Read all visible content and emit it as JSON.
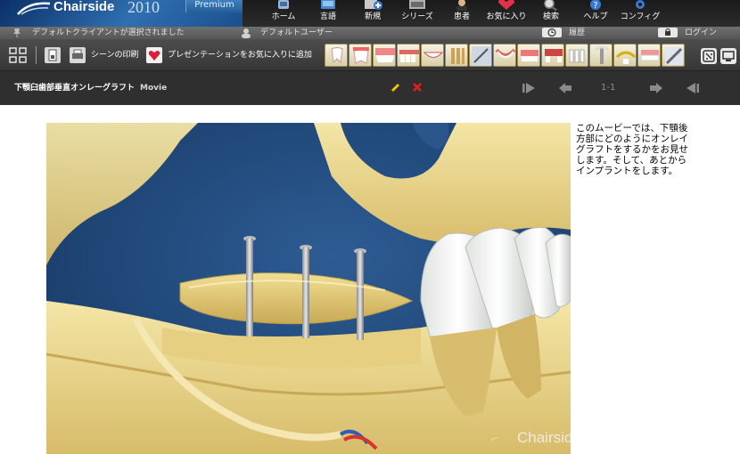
{
  "header": {
    "brand_name": "Chairside",
    "brand_year": "2010",
    "brand_edition": "Premium",
    "nav": [
      {
        "label": "ホーム",
        "icon": "home-icon"
      },
      {
        "label": "言語",
        "icon": "language-icon"
      },
      {
        "label": "新規",
        "icon": "new-icon"
      },
      {
        "label": "シリーズ",
        "icon": "series-icon"
      },
      {
        "label": "患者",
        "icon": "patient-icon"
      },
      {
        "label": "お気に入り",
        "icon": "favorites-icon"
      },
      {
        "label": "検索",
        "icon": "search-icon"
      },
      {
        "label": "ヘルプ",
        "icon": "help-icon"
      },
      {
        "label": "コンフィグ",
        "icon": "config-icon"
      }
    ]
  },
  "status": {
    "client": "デフォルトクライアントが選択されました",
    "user": "デフォルトユーザー",
    "history": "履歴",
    "login": "ログイン"
  },
  "toolbar": {
    "print_scene": "シーンの印刷",
    "add_favorite": "プレゼンテーションをお気に入りに追加"
  },
  "title": {
    "text": "下顎臼歯部垂直オンレーグラフト",
    "media": "Movie",
    "page_count": "1-1"
  },
  "content": {
    "description": "このムービーでは、下顎後方部にどのようにオンレイグラフトをするかをお見せします。そして、あとからインプラントをします。",
    "watermark": "Chairside™"
  },
  "colors": {
    "header_bg": "#222222",
    "brand_blue": "#2f6fb0",
    "title_bg": "#2f2f2f",
    "video_bg": "#224a7e",
    "bone": "#e9d58c",
    "edit": "#f5c400",
    "delete": "#e0201c"
  }
}
